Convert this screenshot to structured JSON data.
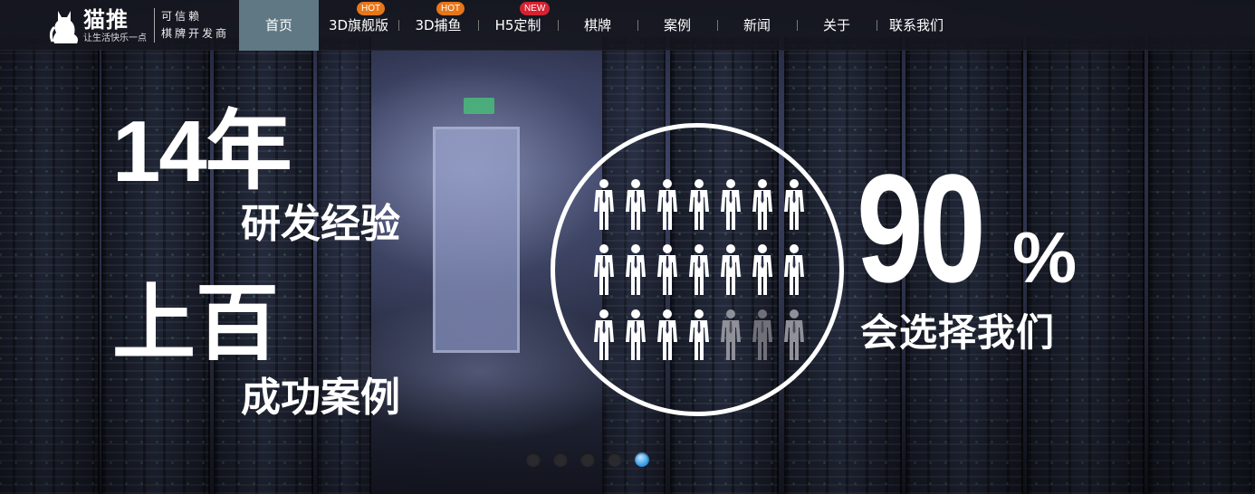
{
  "brand": {
    "name": "猫推",
    "slogan": "让生活快乐一点",
    "tagline_line1": "可信赖",
    "tagline_line2": "棋牌开发商"
  },
  "nav": {
    "items": [
      {
        "label": "首页",
        "active": true,
        "badge": ""
      },
      {
        "label": "3D旗舰版",
        "active": false,
        "badge": "HOT"
      },
      {
        "label": "3D捕鱼",
        "active": false,
        "badge": "HOT"
      },
      {
        "label": "H5定制",
        "active": false,
        "badge": "NEW"
      },
      {
        "label": "棋牌",
        "active": false,
        "badge": ""
      },
      {
        "label": "案例",
        "active": false,
        "badge": ""
      },
      {
        "label": "新闻",
        "active": false,
        "badge": ""
      },
      {
        "label": "关于",
        "active": false,
        "badge": ""
      },
      {
        "label": "联系我们",
        "active": false,
        "badge": ""
      }
    ]
  },
  "hero": {
    "years": "14年",
    "years_sub": "研发经验",
    "hundred": "上百",
    "hundred_sub": "成功案例",
    "percent_value": "90",
    "percent_sign": "%",
    "percent_sub": "会选择我们",
    "people_total": 21,
    "people_highlighted": 18,
    "people_share": 0.9
  },
  "slider": {
    "slide_count": 5,
    "active_index": 4
  },
  "colors": {
    "nav_active_bg": "#5f7884",
    "badge_hot": "#e6761a",
    "badge_new": "#d62230",
    "pager_active": "#3aa0e8"
  }
}
